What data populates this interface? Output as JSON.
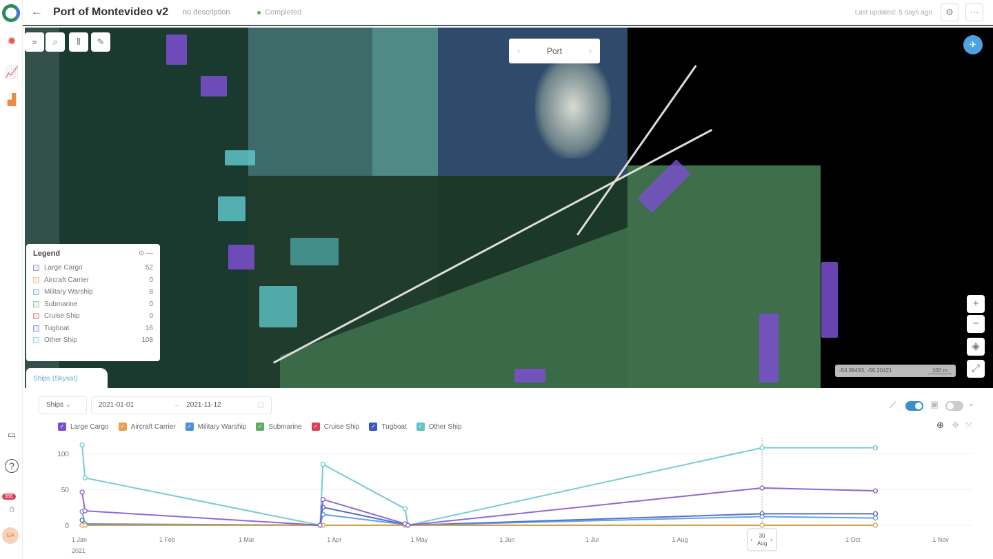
{
  "header": {
    "title": "Port of Montevideo v2",
    "description": "no description",
    "status": "Completed",
    "last_updated": "Last updated: 5 days ago",
    "more": "···"
  },
  "map": {
    "nav_label": "Port",
    "coords": "-54.89493, -56.20421",
    "scale": "100 m"
  },
  "legend": {
    "title": "Legend",
    "items": [
      {
        "name": "Large Cargo",
        "count": "52",
        "color": "#7b4fd0"
      },
      {
        "name": "Aircraft Carrier",
        "count": "0",
        "color": "#e8a14c"
      },
      {
        "name": "Military Warship",
        "count": "8",
        "color": "#4a90d9"
      },
      {
        "name": "Submarine",
        "count": "0",
        "color": "#5fae5f"
      },
      {
        "name": "Cruise Ship",
        "count": "0",
        "color": "#d9405a"
      },
      {
        "name": "Tugboat",
        "count": "16",
        "color": "#3a55c4"
      },
      {
        "name": "Other Ship",
        "count": "108",
        "color": "#5ec4c8"
      }
    ]
  },
  "panel": {
    "tab": "Ships (Skysat)",
    "type_select": "Ships",
    "date_from": "2021-01-01",
    "date_to": "2021-11-12",
    "date_sep": "→",
    "sidebar_badge": "356",
    "avatar": "GA"
  },
  "chart_data": {
    "type": "line",
    "title": "",
    "xlabel": "",
    "ylabel": "",
    "ylim": [
      0,
      120
    ],
    "yticks": [
      "0",
      "50",
      "100"
    ],
    "xticks": [
      {
        "date": "2021-01-01",
        "label": "1 Jan"
      },
      {
        "date": "2021-02-01",
        "label": "1 Feb"
      },
      {
        "date": "2021-03-01",
        "label": "1 Mar"
      },
      {
        "date": "2021-04-01",
        "label": "1 Apr"
      },
      {
        "date": "2021-05-01",
        "label": "1 May"
      },
      {
        "date": "2021-06-01",
        "label": "1 Jun"
      },
      {
        "date": "2021-07-01",
        "label": "1 Jul"
      },
      {
        "date": "2021-08-01",
        "label": "1 Aug"
      },
      {
        "date": "2021-10-01",
        "label": "1 Oct"
      },
      {
        "date": "2021-11-01",
        "label": "1 Nov"
      }
    ],
    "year_label": "2021",
    "cursor": {
      "date": "2021-08-30",
      "day": "30",
      "month": "Aug"
    },
    "x": [
      "2021-01-02",
      "2021-01-03",
      "2021-03-27",
      "2021-03-28",
      "2021-04-26",
      "2021-04-27",
      "2021-08-30",
      "2021-10-09"
    ],
    "series": [
      {
        "name": "Large Cargo",
        "color": "#7b4fd0",
        "values": [
          46,
          20,
          0,
          36,
          2,
          0,
          52,
          48
        ]
      },
      {
        "name": "Aircraft Carrier",
        "color": "#e8a14c",
        "values": [
          0,
          0,
          0,
          0,
          0,
          0,
          0,
          0
        ]
      },
      {
        "name": "Military Warship",
        "color": "#4a90d9",
        "values": [
          19,
          2,
          0,
          15,
          1,
          0,
          12,
          10
        ]
      },
      {
        "name": "Submarine",
        "color": "#5fae5f",
        "values": [
          0,
          0,
          0,
          0,
          0,
          0,
          0,
          0
        ]
      },
      {
        "name": "Cruise Ship",
        "color": "#d9405a",
        "values": [
          0,
          0,
          0,
          0,
          0,
          0,
          0,
          0
        ]
      },
      {
        "name": "Tugboat",
        "color": "#3a55c4",
        "values": [
          7,
          1,
          0,
          25,
          1,
          0,
          16,
          16
        ]
      },
      {
        "name": "Other Ship",
        "color": "#5ec4c8",
        "values": [
          112,
          66,
          0,
          85,
          23,
          0,
          108,
          108
        ]
      }
    ]
  }
}
